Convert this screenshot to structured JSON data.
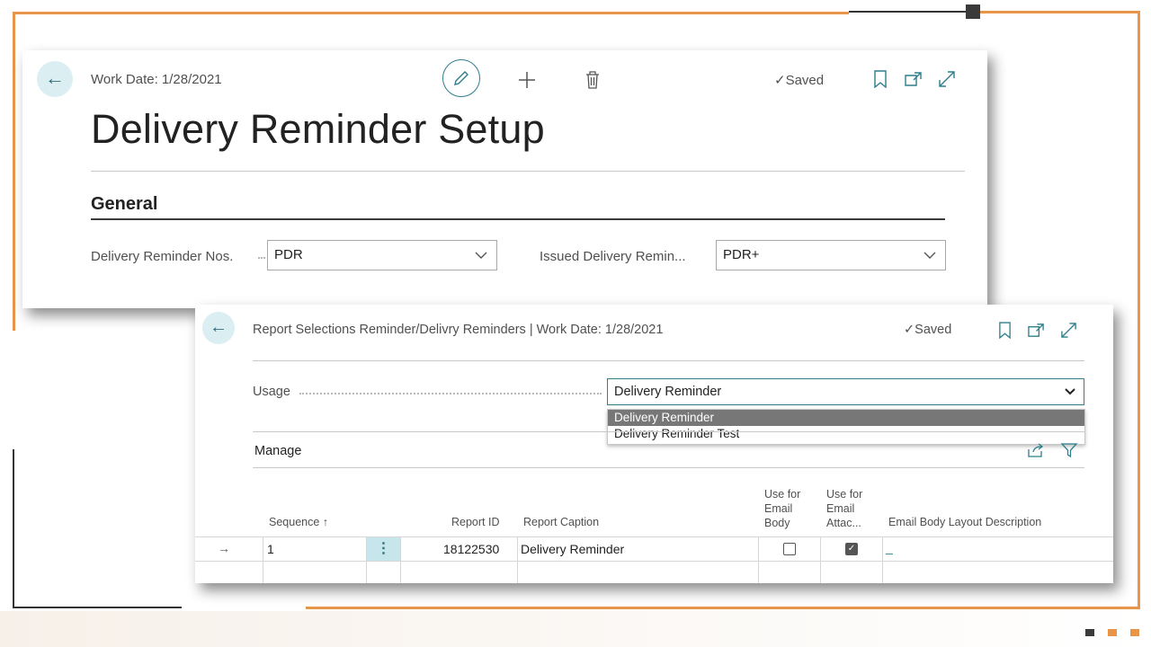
{
  "window1": {
    "work_date": "Work Date: 1/28/2021",
    "saved": "Saved",
    "title": "Delivery Reminder Setup",
    "section": "General",
    "fields": [
      {
        "label": "Delivery Reminder Nos.",
        "value": "PDR"
      },
      {
        "label": "Issued Delivery Remin...",
        "value": "PDR+"
      }
    ]
  },
  "window2": {
    "header": "Report Selections Reminder/Delivry Reminders | Work Date: 1/28/2021",
    "saved": "Saved",
    "usage_label": "Usage",
    "usage_value": "Delivery Reminder",
    "dropdown_options": [
      "Delivery Reminder",
      "Delivery Reminder Test"
    ],
    "manage_label": "Manage",
    "columns": {
      "sequence": "Sequence ↑",
      "report_id": "Report ID",
      "report_caption": "Report Caption",
      "use_email_body": [
        "Use for",
        "Email",
        "Body"
      ],
      "use_email_attach": [
        "Use for",
        "Email",
        "Attac..."
      ],
      "email_layout_desc": "Email Body Layout Description"
    },
    "rows": [
      {
        "sequence": "1",
        "report_id": "18122530",
        "report_caption": "Delivery Reminder",
        "use_email_body": false,
        "use_email_attach": true,
        "email_layout_desc": "_"
      }
    ]
  },
  "colors": {
    "accent": "#E8954A",
    "teal": "#2e7e8c"
  }
}
